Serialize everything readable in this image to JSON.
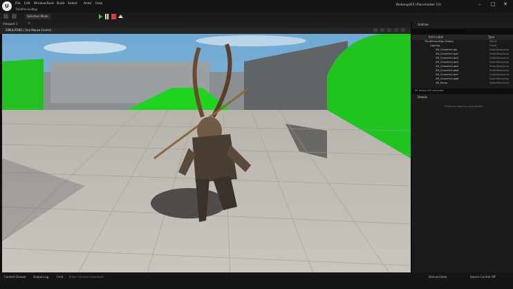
{
  "app": {
    "logo_text": "U",
    "menu": [
      "File",
      "Edit",
      "Window",
      "Tools",
      "Build",
      "Select",
      "Actor",
      "Help"
    ],
    "level_tab": "ThirdPersonMap",
    "project_name": "WukongUE5 (Placeholder 13)",
    "window_controls": [
      "–",
      "□",
      "✕"
    ]
  },
  "toolbar": {
    "mode_select": "Selection Mode",
    "play_icons": [
      "play-icon",
      "pause-icon",
      "stop-icon",
      "eject-icon"
    ]
  },
  "viewport": {
    "tab_label": "Viewport 1",
    "close": "✕",
    "header_label": "SIMULATING | Use Mouse Control"
  },
  "outliner": {
    "tab_label": "Outliner",
    "column_label": "Item Label",
    "column_type": "Type",
    "rows": [
      {
        "name": "ThirdPersonMap (Editor)",
        "type": "World"
      },
      {
        "name": "Lighting",
        "type": "Folder"
      },
      {
        "name": "SM_ChamferCube",
        "type": "StaticMeshActor"
      },
      {
        "name": "SM_ChamferCube2",
        "type": "StaticMeshActor"
      },
      {
        "name": "SM_ChamferCube3",
        "type": "StaticMeshActor"
      },
      {
        "name": "SM_ChamferCube4",
        "type": "StaticMeshActor"
      },
      {
        "name": "SM_ChamferCube5",
        "type": "StaticMeshActor"
      },
      {
        "name": "SM_ChamferCube6",
        "type": "StaticMeshActor"
      },
      {
        "name": "SM_ChamferCube7",
        "type": "StaticMeshActor"
      },
      {
        "name": "SM_ChamferCube8",
        "type": "StaticMeshActor"
      },
      {
        "name": "SM_Ramp",
        "type": "StaticMeshActor"
      }
    ],
    "actor_count": "55 actors (55 selected)"
  },
  "details": {
    "tab_label": "Details",
    "hint": "Select an object to view details."
  },
  "statusbar": {
    "content_drawer": "Content Drawer",
    "output_log": "Output Log",
    "cmd": "Cmd",
    "cmd_placeholder": "Enter Console Command",
    "derived_data": "Derived Data",
    "source_control": "Source Control Off"
  },
  "colors": {
    "sky": "#7fb4d8",
    "floor": "#bdb8b0",
    "green": "#1fcf1f",
    "wall": "#757b7d",
    "panel": "#1b1b1b"
  }
}
